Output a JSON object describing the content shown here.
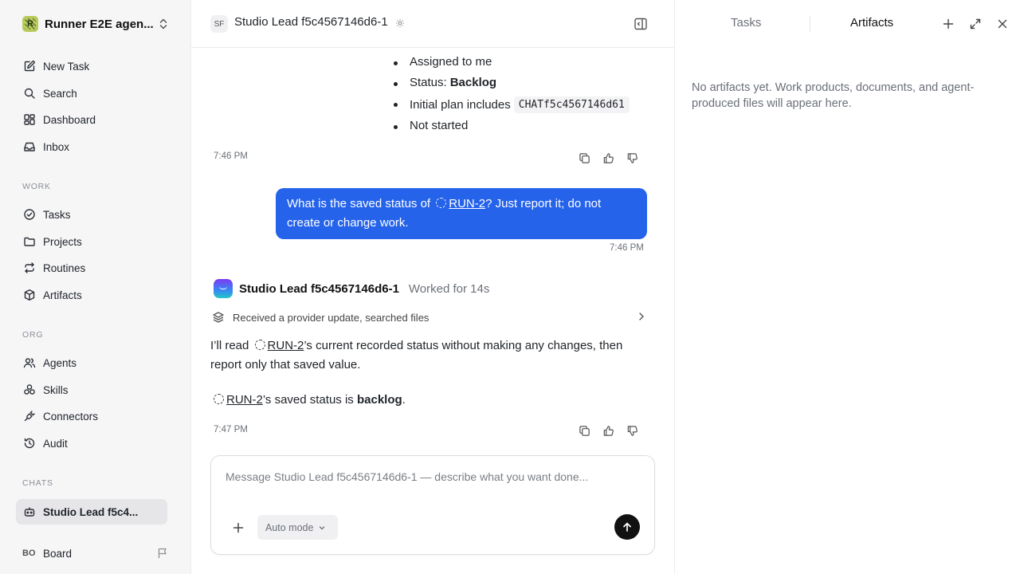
{
  "workspace": {
    "name": "Runner E2E agen...",
    "logo_letter": "R"
  },
  "sidebar": {
    "top": [
      {
        "label": "New Task",
        "icon": "edit-icon"
      },
      {
        "label": "Search",
        "icon": "search-icon"
      },
      {
        "label": "Dashboard",
        "icon": "dashboard-icon"
      },
      {
        "label": "Inbox",
        "icon": "inbox-icon"
      }
    ],
    "work_label": "WORK",
    "work": [
      {
        "label": "Tasks",
        "icon": "check-circle-icon"
      },
      {
        "label": "Projects",
        "icon": "folder-icon"
      },
      {
        "label": "Routines",
        "icon": "repeat-icon"
      },
      {
        "label": "Artifacts",
        "icon": "box-icon"
      }
    ],
    "org_label": "ORG",
    "org": [
      {
        "label": "Agents",
        "icon": "users-icon"
      },
      {
        "label": "Skills",
        "icon": "skills-icon"
      },
      {
        "label": "Connectors",
        "icon": "plug-icon"
      },
      {
        "label": "Audit",
        "icon": "history-icon"
      }
    ],
    "chats_label": "CHATS",
    "chats": [
      {
        "label": "Studio Lead f5c4...",
        "icon": "robot-icon"
      }
    ],
    "footer": {
      "initials": "BO",
      "label": "Board"
    }
  },
  "chat": {
    "header": {
      "initials": "SF",
      "title": "Studio Lead f5c4567146d6-1"
    },
    "prev_bullets": {
      "b1": "Assigned to me",
      "b2_prefix": "Status: ",
      "b2_bold": "Backlog",
      "b3_prefix": "Initial plan includes",
      "b3_code": "CHATf5c4567146d61",
      "b4": "Not started"
    },
    "prev_time": "7:46 PM",
    "user_message": {
      "before": "What is the saved status of",
      "ref": "RUN-2",
      "after": "? Just report it; do not create or change work.",
      "time": "7:46 PM"
    },
    "agent": {
      "name": "Studio Lead f5c4567146d6-1",
      "worked": "Worked for 14s",
      "activity": "Received a provider update, searched files",
      "p1_before": "I’ll read",
      "p1_ref": "RUN-2",
      "p1_after": "’s current recorded status without making any changes, then report only that saved value.",
      "p2_ref": "RUN-2",
      "p2_mid": "’s saved status is",
      "p2_bold": "backlog",
      "p2_end": ".",
      "time": "7:47 PM"
    },
    "composer": {
      "placeholder": "Message Studio Lead f5c4567146d6-1 — describe what you want done...",
      "mode": "Auto mode"
    }
  },
  "panel": {
    "tabs": {
      "tasks": "Tasks",
      "artifacts": "Artifacts"
    },
    "active_tab": "Artifacts",
    "empty_text": "No artifacts yet. Work products, documents, and agent-produced files will appear here."
  },
  "colors": {
    "accent": "#2563eb",
    "sidebar_bg": "#f6f6f7",
    "send_button": "#111111"
  }
}
